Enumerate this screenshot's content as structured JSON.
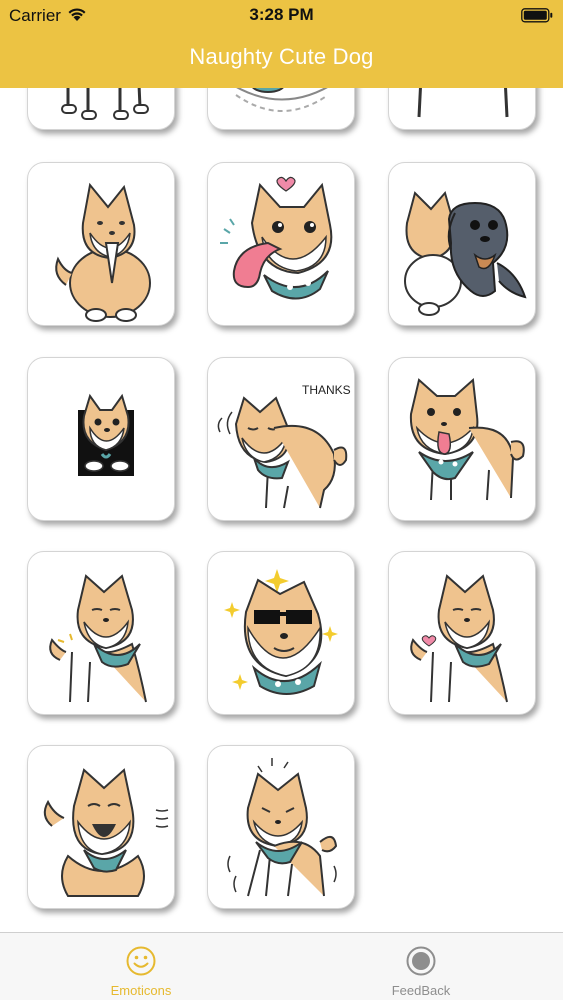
{
  "status_bar": {
    "carrier": "Carrier",
    "time": "3:28 PM"
  },
  "nav": {
    "title": "Naughty Cute Dog"
  },
  "stickers": [
    {
      "name": "sticker-dog-standing-partial"
    },
    {
      "name": "sticker-dog-sleeping-partial"
    },
    {
      "name": "sticker-dog-bandana-partial"
    },
    {
      "name": "sticker-dog-praying"
    },
    {
      "name": "sticker-dog-tongue-out-heart"
    },
    {
      "name": "sticker-dog-hugging-dachshund"
    },
    {
      "name": "sticker-dog-peeking-box"
    },
    {
      "name": "sticker-dog-thanks"
    },
    {
      "name": "sticker-dog-tongue-standing"
    },
    {
      "name": "sticker-dog-heart-shy"
    },
    {
      "name": "sticker-dog-sunglasses"
    },
    {
      "name": "sticker-dog-heart-shy-2"
    },
    {
      "name": "sticker-dog-laughing"
    },
    {
      "name": "sticker-dog-shaking"
    }
  ],
  "sticker_text": {
    "thanks": "THANKS"
  },
  "tabs": {
    "emoticons": {
      "label": "Emoticons",
      "icon": "smiley-icon",
      "active": true
    },
    "feedback": {
      "label": "FeedBack",
      "icon": "record-circle-icon",
      "active": false
    }
  },
  "colors": {
    "header": "#ecc343",
    "title": "#ffffff",
    "dog_fur": "#efc38e",
    "bandana": "#5aa6a8",
    "tab_active": "#e6b92f",
    "tab_inactive": "#8e8e8e"
  }
}
